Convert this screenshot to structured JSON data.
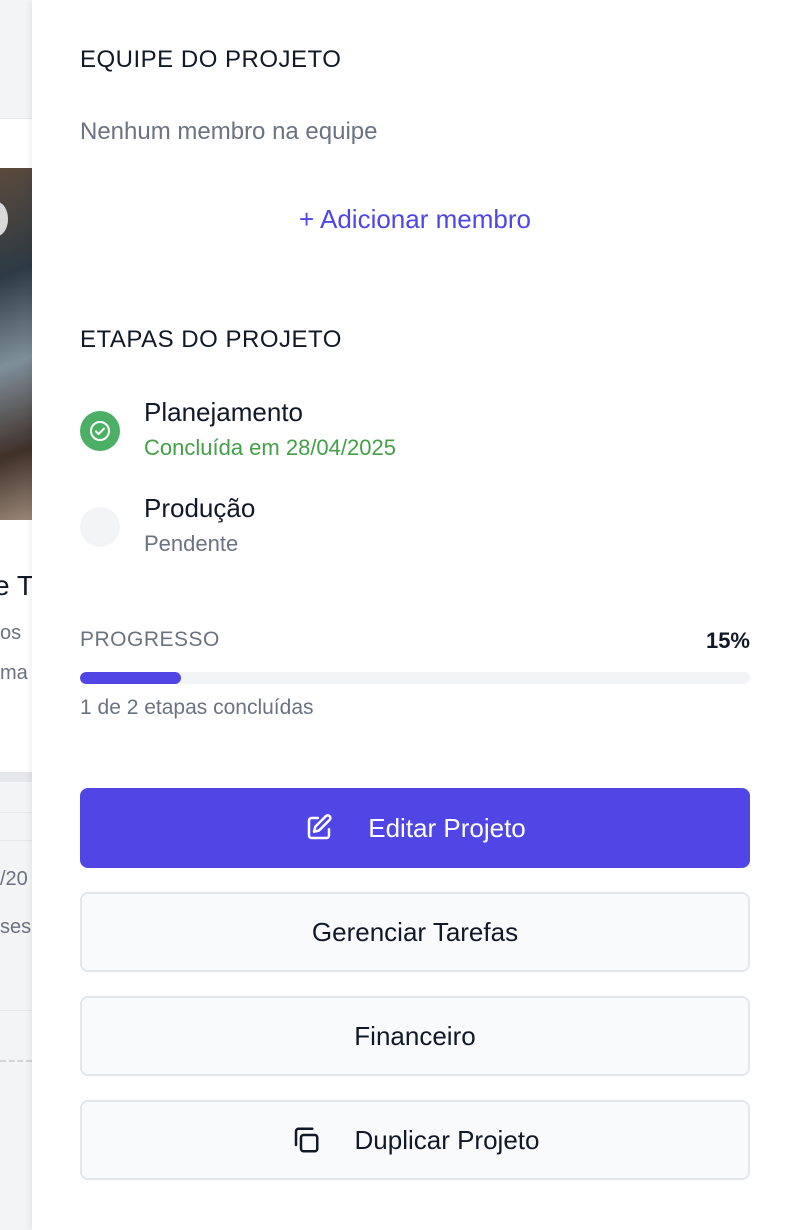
{
  "background": {
    "title_fragment": "e T",
    "text_lines": [
      "os",
      "ma",
      "/20",
      "ses"
    ]
  },
  "team": {
    "title": "EQUIPE DO PROJETO",
    "empty_text": "Nenhum membro na equipe",
    "add_label": "+ Adicionar membro"
  },
  "stages": {
    "title": "ETAPAS DO PROJETO",
    "items": [
      {
        "name": "Planejamento",
        "status": "Concluída em 28/04/2025",
        "state": "done"
      },
      {
        "name": "Produção",
        "status": "Pendente",
        "state": "pending"
      }
    ]
  },
  "progress": {
    "label": "PROGRESSO",
    "percent_text": "15%",
    "percent": 15,
    "caption": "1 de 2 etapas concluídas"
  },
  "actions": {
    "edit": "Editar Projeto",
    "tasks": "Gerenciar Tarefas",
    "finance": "Financeiro",
    "duplicate": "Duplicar Projeto"
  },
  "colors": {
    "accent": "#4f46e5",
    "success": "#4caf66",
    "muted": "#6b7280"
  },
  "icons": {
    "stage_done": "check-circle-icon",
    "edit": "edit-square-icon",
    "duplicate": "copy-icon"
  }
}
